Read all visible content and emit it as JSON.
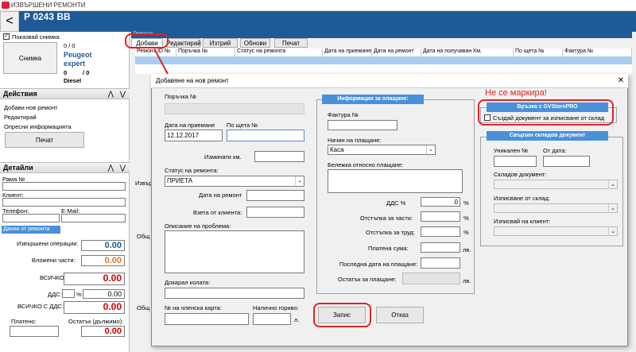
{
  "window": {
    "title": "ИЗВЪРШЕНИ РЕМОНТИ",
    "plate": "Р 0243 ВВ"
  },
  "left": {
    "show_photo_label": "Показвай снимка",
    "photo_button": "Снимка",
    "counter1": "0 / 0",
    "make": "Peugeot",
    "model": "expert",
    "counter2a": "0",
    "counter2b": "/ 0",
    "fuel": "Diesel",
    "actions_title": "Действия",
    "actions": [
      "Добави нов ремонт",
      "Редактирай",
      "Опресни информацията"
    ],
    "print_button": "Печат",
    "details_title": "Детайли",
    "frame_label": "Рама №",
    "client_label": "Клиент:",
    "phone_label": "Телефон:",
    "email_label": "E-Mail:",
    "data_tab": "Данни от ремонта",
    "done_ops_label": "Извършени операции:",
    "done_ops_value": "0.00",
    "parts_label": "Вложени части:",
    "parts_value": "0.00",
    "total_label": "ВСИЧКО:",
    "total_value": "0.00",
    "vat_label": "ДДС:",
    "vat_percent": "%",
    "vat_value": "0.00",
    "total_vat_label": "ВСИЧКО С ДДС:",
    "total_vat_value": "0.00",
    "paid_label": "Платено:",
    "balance_label": "Остатък (дължимо):",
    "balance_value": "0.00"
  },
  "remont": {
    "tab": "Ремонти",
    "toolbar": [
      "Добави",
      "Редактирай",
      "Изтрий",
      "Обнови",
      "Печат"
    ],
    "columns": [
      "Ремонт ID №",
      "Поръчка №",
      "Статус на ремонта",
      "Дата на приемане",
      "Дата на ремонт",
      "Дата на получаван Км.",
      "По щета №",
      "Фактура №"
    ],
    "bg_labels": [
      "Извър",
      "Общ",
      "Общ"
    ]
  },
  "dialog": {
    "title": "Добавяне на нов ремонт",
    "close": "✕",
    "order_label": "Поръчка №",
    "date_label": "Дата на приемане",
    "date_value": "12.12.2017",
    "claim_label": "По щета №",
    "km_label": "Изминати км.",
    "status_label": "Статус на ремонта:",
    "status_value": "ПРИЕТА",
    "repair_date_label": "Дата на ремонт",
    "taken_label": "Взета от клиента:",
    "problem_label": "Описание на проблема:",
    "brought_label": "Докарал колата:",
    "card_label": "№ на членска карта:",
    "fuel_label": "Налично гориво:",
    "fuel_unit": "л.",
    "pay_header": "Информация за плащане:",
    "invoice_label": "Фактура №",
    "pay_method_label": "Начин на плащане:",
    "pay_method_value": "Каса",
    "pay_note_label": "Бележка относно плащане:",
    "vat_label": "ДДС %",
    "vat_value": "0",
    "pct": "%",
    "parts_disc_label": "Отстъпка за части:",
    "labor_disc_label": "Отстъпка за труд:",
    "paid_label": "Платена сума:",
    "paid_unit": "лв.",
    "last_pay_label": "Последна дата на плащане:",
    "remaining_label": "Остатък за плащане:",
    "remaining_unit": "лв.",
    "gv_header": "Връзка с GVStorePRO",
    "gv_checkbox": "Създай документ за изписване от склад",
    "stock_header": "Свързан складов документ",
    "unique_label": "Уникален №",
    "from_date_label": "От дата:",
    "stock_doc_label": "Складов документ:",
    "issued_from_label": "Изписване от склад:",
    "issued_client_label": "Изписвай на клиент:",
    "save_button": "Запис",
    "cancel_button": "Отказ"
  },
  "annotation": {
    "note": "Не се маркира!"
  },
  "colors": {
    "header": "#1e5a96",
    "accent": "#4a90d9",
    "alert": "#e0242a"
  }
}
